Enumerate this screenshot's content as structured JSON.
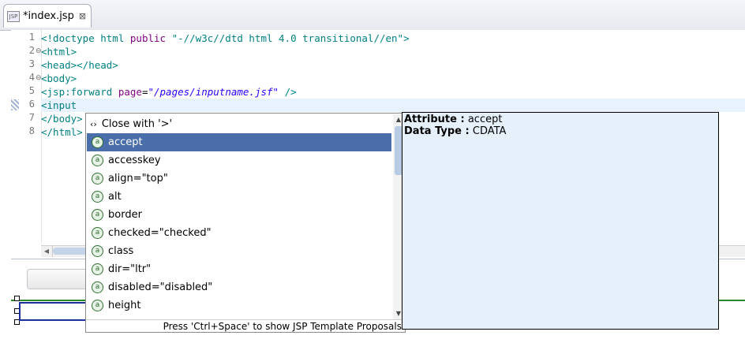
{
  "tab": {
    "title": "*index.jsp",
    "icon": "jsp-file-icon",
    "close": "⊠"
  },
  "editor": {
    "lines": [
      {
        "num": "1",
        "fold": "",
        "parts": [
          [
            "tag",
            "<!doctype html "
          ],
          [
            "attr",
            "public "
          ],
          [
            "tag",
            "\"-//w3c//dtd html 4.0 transitional//en\">"
          ]
        ]
      },
      {
        "num": "2",
        "fold": "⊖",
        "parts": [
          [
            "tag",
            "<html>"
          ]
        ]
      },
      {
        "num": "3",
        "fold": "",
        "parts": [
          [
            "tag",
            "<head></head>"
          ]
        ]
      },
      {
        "num": "4",
        "fold": "⊖",
        "parts": [
          [
            "tag",
            "<body>"
          ]
        ]
      },
      {
        "num": "5",
        "fold": "",
        "parts": [
          [
            "tag",
            "<jsp:forward "
          ],
          [
            "attr",
            "page"
          ],
          [
            "plain",
            "="
          ],
          [
            "str",
            "\"/pages/inputname.jsf\""
          ],
          [
            "tag",
            " />"
          ]
        ]
      },
      {
        "num": "6",
        "fold": "",
        "parts": [
          [
            "tag",
            "<input "
          ]
        ]
      },
      {
        "num": "7",
        "fold": "",
        "parts": [
          [
            "tag",
            "</body>"
          ]
        ]
      },
      {
        "num": "8",
        "fold": "",
        "parts": [
          [
            "tag",
            "</html>"
          ]
        ]
      }
    ],
    "current_line": 6
  },
  "popup": {
    "close_label": "Close with  '>'",
    "items": [
      "accept",
      "accesskey",
      "align=\"top\"",
      "alt",
      "border",
      "checked=\"checked\"",
      "class",
      "dir=\"ltr\"",
      "disabled=\"disabled\"",
      "height"
    ],
    "selected_index": 0,
    "footer": "Press 'Ctrl+Space' to show JSP Template Proposals"
  },
  "info": {
    "attribute_label": "Attribute :",
    "attribute_value": "accept",
    "datatype_label": "Data Type :",
    "datatype_value": "CDATA"
  },
  "colors": {
    "tag": "#008080",
    "attr": "#7f007f",
    "string": "#2a00ff",
    "selection": "#4a6ea9",
    "info_bg": "#e5f0fb"
  }
}
